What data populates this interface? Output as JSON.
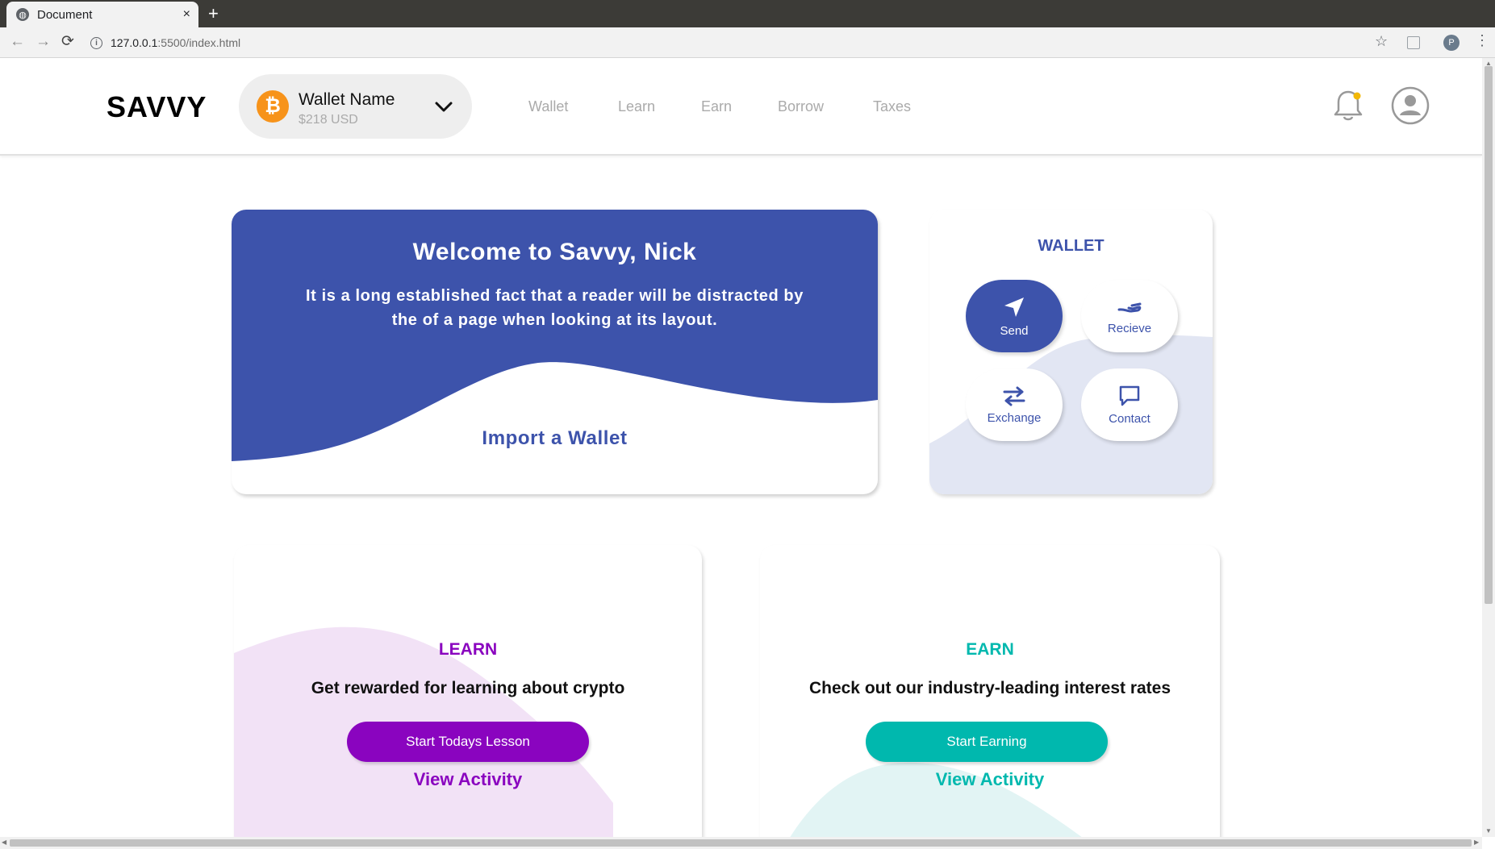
{
  "browser": {
    "tab_title": "Document",
    "tab_close": "×",
    "new_tab": "+",
    "url_host": "127.0.0.1",
    "url_path": ":5500/index.html",
    "profile_initial": "P"
  },
  "header": {
    "logo": "SAVVY",
    "wallet_name": "Wallet Name",
    "wallet_balance": "$218 USD",
    "btc_symbol": "₿",
    "nav": [
      "Wallet",
      "Learn",
      "Earn",
      "Borrow",
      "Taxes"
    ],
    "notification_dot_color": "#f2b705"
  },
  "welcome": {
    "title": "Welcome to Savvy, Nick",
    "text": "It is a long established fact that a reader will be distracted by the of a page when looking at its layout.",
    "import_link": "Import a Wallet"
  },
  "wallet_card": {
    "title": "WALLET",
    "actions": [
      {
        "label": "Send",
        "icon": "send-icon"
      },
      {
        "label": "Recieve",
        "icon": "receive-icon"
      },
      {
        "label": "Exchange",
        "icon": "exchange-icon"
      },
      {
        "label": "Contact",
        "icon": "chat-icon"
      }
    ]
  },
  "learn": {
    "title": "LEARN",
    "subtitle": "Get rewarded for learning about crypto",
    "button": "Start Todays Lesson",
    "link": "View Activity",
    "accent": "#8a04bf"
  },
  "earn": {
    "title": "EARN",
    "subtitle": "Check out our industry-leading interest rates",
    "button": "Start Earning",
    "link": "View Activity",
    "accent": "#00b8ae"
  },
  "colors": {
    "brand_blue": "#3d53ab",
    "bitcoin_orange": "#f7931a"
  }
}
